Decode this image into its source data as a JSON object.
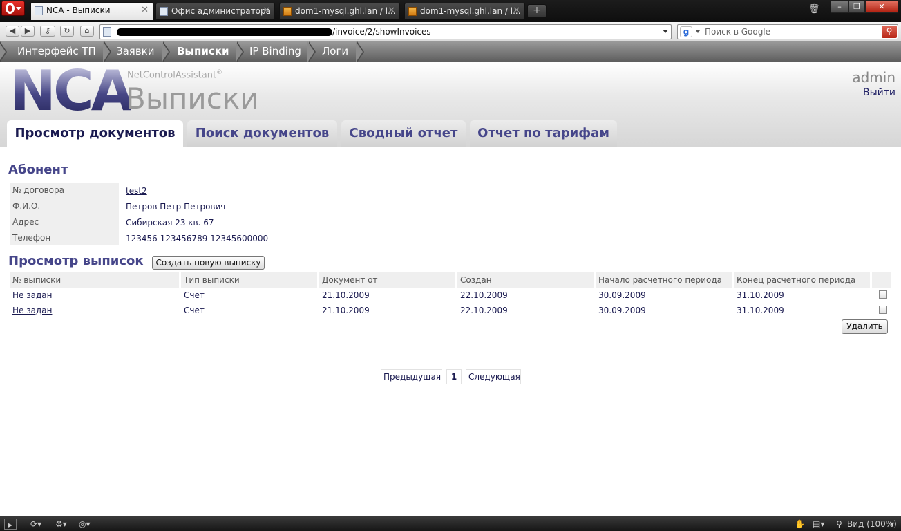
{
  "browser": {
    "tabs": [
      {
        "title": "NCA - Выписки",
        "active": true,
        "favicon": "page-icon"
      },
      {
        "title": "Офис администратора",
        "active": false,
        "favicon": "page-icon"
      },
      {
        "title": "dom1-mysql.ghl.lan / l...",
        "active": false,
        "favicon": "phpmyadmin-icon"
      },
      {
        "title": "dom1-mysql.ghl.lan / l...",
        "active": false,
        "favicon": "phpmyadmin-icon"
      }
    ],
    "url_visible": "/invoice/2/showInvoices",
    "search_placeholder": "Поиск в Google"
  },
  "appnav": {
    "items": [
      {
        "label": "Интерфейс ТП",
        "current": false
      },
      {
        "label": "Заявки",
        "current": false
      },
      {
        "label": "Выписки",
        "current": true
      },
      {
        "label": "IP Binding",
        "current": false
      },
      {
        "label": "Логи",
        "current": false
      }
    ]
  },
  "header": {
    "logo": "NCA",
    "product": "NetControlAssistant",
    "product_mark": "®",
    "title": "Выписки",
    "user": "admin",
    "logout": "Выйти"
  },
  "page_tabs": [
    {
      "label": "Просмотр документов",
      "active": true
    },
    {
      "label": "Поиск документов",
      "active": false
    },
    {
      "label": "Сводный отчет",
      "active": false
    },
    {
      "label": "Отчет по тарифам",
      "active": false
    }
  ],
  "subscriber": {
    "heading": "Абонент",
    "rows": [
      {
        "label": "№ договора",
        "value": "test2",
        "link": true
      },
      {
        "label": "Ф.И.О.",
        "value": "Петров Петр Петрович",
        "link": false
      },
      {
        "label": "Адрес",
        "value": "Сибирская 23 кв. 67",
        "link": false
      },
      {
        "label": "Телефон",
        "value": "123456 123456789 12345600000",
        "link": false
      }
    ]
  },
  "invoices": {
    "heading": "Просмотр выписок",
    "create_button": "Создать новую выписку",
    "columns": [
      "№ выписки",
      "Тип выписки",
      "Документ от",
      "Создан",
      "Начало расчетного периода",
      "Конец расчетного периода"
    ],
    "rows": [
      {
        "number": "Не задан",
        "type": "Счет",
        "doc_date": "21.10.2009",
        "created": "22.10.2009",
        "period_start": "30.09.2009",
        "period_end": "31.10.2009"
      },
      {
        "number": "Не задан",
        "type": "Счет",
        "doc_date": "21.10.2009",
        "created": "22.10.2009",
        "period_start": "30.09.2009",
        "period_end": "31.10.2009"
      }
    ],
    "delete_button": "Удалить"
  },
  "pager": {
    "prev": "Предыдущая",
    "page": "1",
    "next": "Следующая"
  },
  "statusbar": {
    "zoom": "Вид (100%)"
  }
}
